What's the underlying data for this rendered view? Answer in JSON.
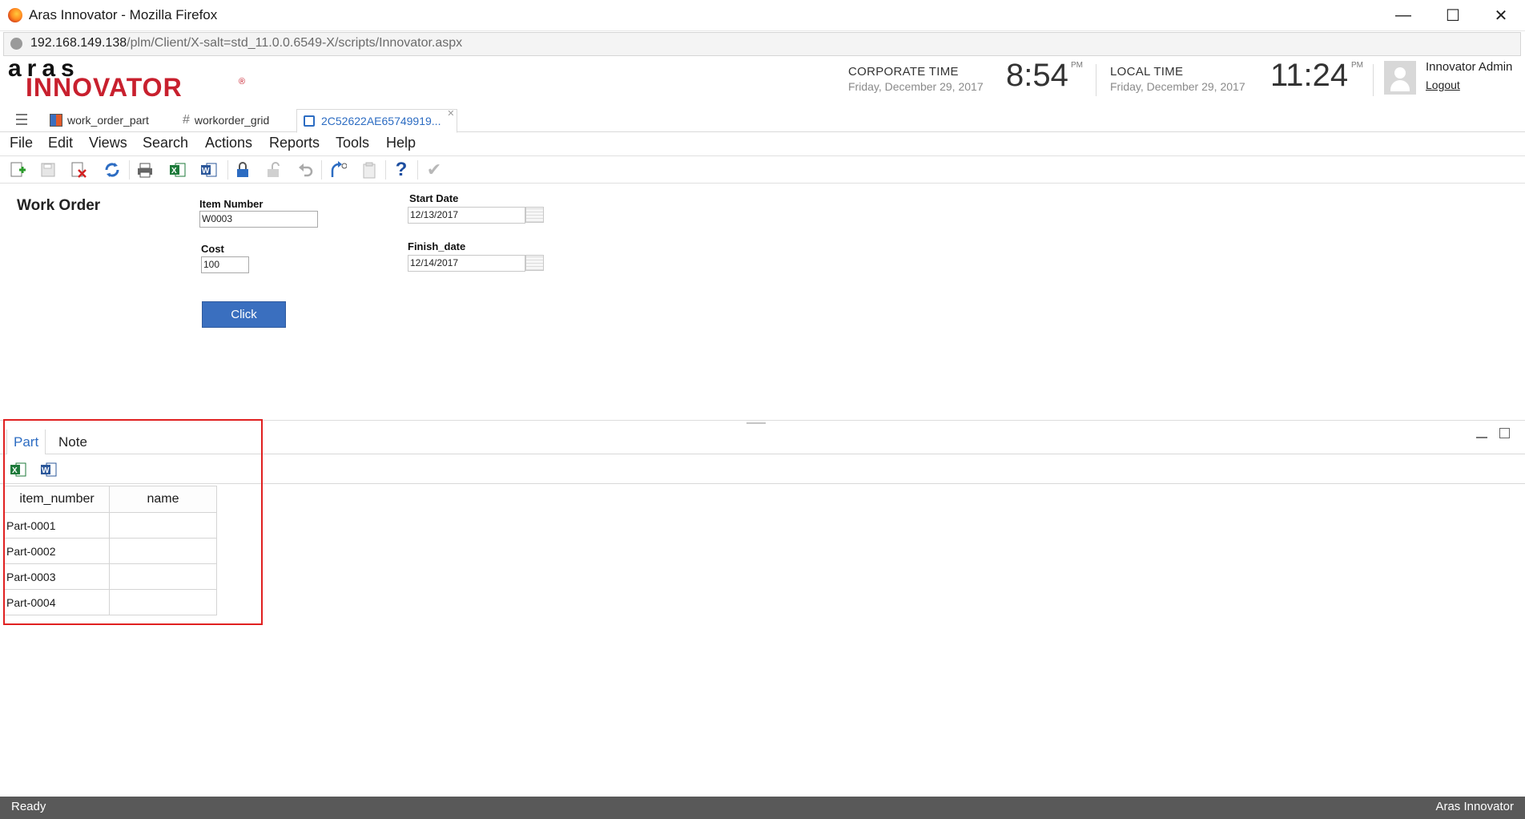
{
  "window": {
    "title": "Aras Innovator - Mozilla Firefox",
    "minimize": "—",
    "maximize": "☐",
    "close": "✕"
  },
  "address_bar": {
    "host": "192.168.149.138",
    "path": "/plm/Client/X-salt=std_11.0.0.6549-X/scripts/Innovator.aspx"
  },
  "logo": {
    "line1": "aras",
    "line2": "INNOVATOR",
    "reg": "®"
  },
  "corporate_clock": {
    "label": "CORPORATE TIME",
    "date": "Friday, December 29, 2017",
    "time": "8:54",
    "ampm": "PM"
  },
  "local_clock": {
    "label": "LOCAL TIME",
    "date": "Friday, December 29, 2017",
    "time": "11:24",
    "ampm": "PM"
  },
  "user": {
    "name": "Innovator Admin",
    "logout": "Logout"
  },
  "tabs": [
    {
      "label": "work_order_part",
      "icon": "itemtype-icon"
    },
    {
      "label": "workorder_grid",
      "icon": "grid-icon"
    },
    {
      "label": "2C52622AE65749919...",
      "icon": "form-icon",
      "active": true
    }
  ],
  "menu": [
    "File",
    "Edit",
    "Views",
    "Search",
    "Actions",
    "Reports",
    "Tools",
    "Help"
  ],
  "toolbar_icons": [
    "new-icon",
    "save-icon",
    "delete-icon",
    "refresh-icon",
    "print-icon",
    "excel-icon",
    "word-icon",
    "lock-icon",
    "unlock-icon",
    "undo-icon",
    "promote-icon",
    "clipboard-icon",
    "help-icon",
    "done-icon"
  ],
  "form": {
    "title": "Work Order",
    "item_number_label": "Item Number",
    "item_number_value": "W0003",
    "cost_label": "Cost",
    "cost_value": "100",
    "start_date_label": "Start Date",
    "start_date_value": "12/13/2017",
    "finish_date_label": "Finish_date",
    "finish_date_value": "12/14/2017",
    "button_label": "Click"
  },
  "relationship": {
    "tabs": [
      "Part",
      "Note"
    ],
    "active_tab": "Part",
    "columns": [
      "item_number",
      "name"
    ],
    "rows": [
      [
        "Part-0001",
        ""
      ],
      [
        "Part-0002",
        ""
      ],
      [
        "Part-0003",
        ""
      ],
      [
        "Part-0004",
        ""
      ]
    ]
  },
  "status": {
    "left": "Ready",
    "right": "Aras Innovator"
  },
  "colors": {
    "brand_red": "#c8202e",
    "accent_blue": "#3a6fbf",
    "highlight_red": "#e02020",
    "status_bg": "#595959"
  }
}
